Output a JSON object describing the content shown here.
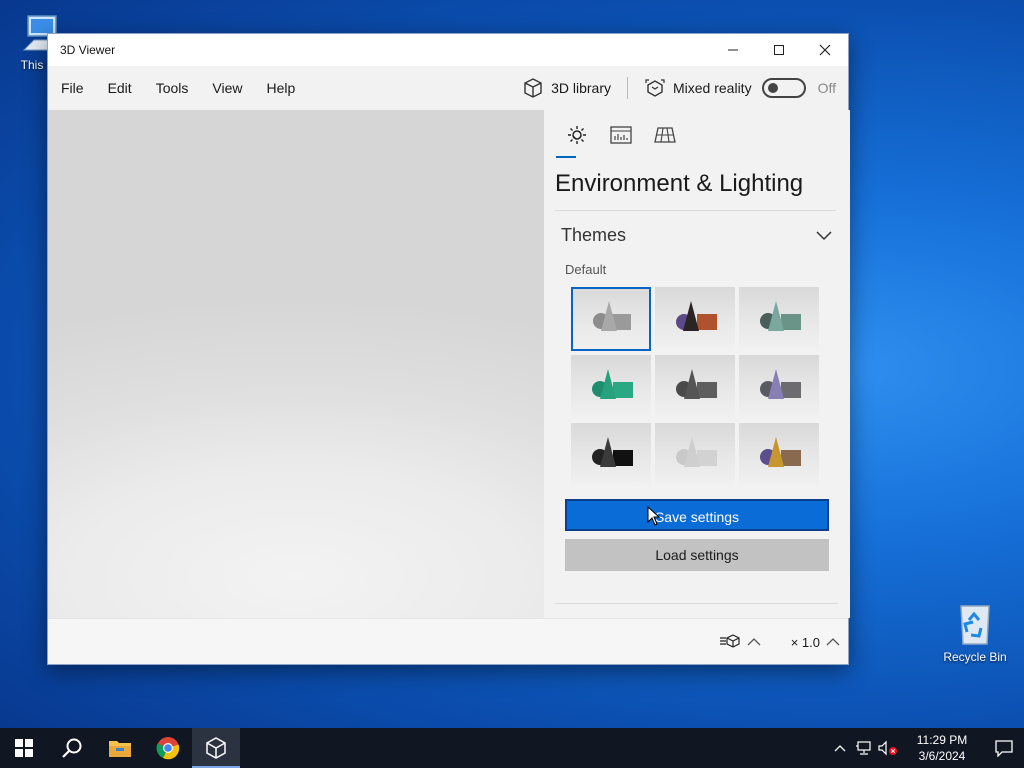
{
  "desktop": {
    "icons": [
      {
        "label": "This PC"
      },
      {
        "label": "Recycle Bin"
      }
    ]
  },
  "window": {
    "title": "3D Viewer",
    "menu": [
      "File",
      "Edit",
      "Tools",
      "View",
      "Help"
    ],
    "library_label": "3D library",
    "mixed_reality_label": "Mixed reality",
    "toggle_state": "Off"
  },
  "panel": {
    "tabs": [
      {
        "icon": "lighting-icon",
        "active": true
      },
      {
        "icon": "stats-icon",
        "active": false
      },
      {
        "icon": "grid-icon",
        "active": false
      }
    ],
    "title": "Environment & Lighting",
    "themes": {
      "heading": "Themes",
      "subheading": "Default",
      "items": [
        {
          "name": "default",
          "selected": true
        },
        {
          "name": "dark-red"
        },
        {
          "name": "teal"
        },
        {
          "name": "green"
        },
        {
          "name": "graphite"
        },
        {
          "name": "violet"
        },
        {
          "name": "black"
        },
        {
          "name": "light"
        },
        {
          "name": "bronze"
        }
      ]
    },
    "save_label": "Save settings",
    "load_label": "Load settings"
  },
  "statusbar": {
    "speed": "× 1.0"
  },
  "taskbar": {
    "time": "11:29 PM",
    "date": "3/6/2024"
  },
  "colors": {
    "accent": "#0a6cd6",
    "desktop": "#1670d8",
    "taskbar": "#111722"
  }
}
